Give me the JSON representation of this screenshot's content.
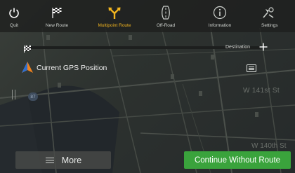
{
  "toolbar": {
    "items": [
      {
        "label": "Quit",
        "icon": "power-icon"
      },
      {
        "label": "New Route",
        "icon": "checkered-flag-icon"
      },
      {
        "label": "Multipoint Route",
        "icon": "fork-route-icon"
      },
      {
        "label": "Off-Road",
        "icon": "off-road-icon"
      },
      {
        "label": "Information",
        "icon": "info-icon"
      },
      {
        "label": "Settings",
        "icon": "settings-icon"
      }
    ],
    "active_index": 2,
    "active_color": "#f2b51f"
  },
  "route": {
    "destination_label": "Destination",
    "start_label": "Current GPS Position"
  },
  "map": {
    "street_1": "W 141st St",
    "street_2": "W 140th St",
    "road_number": "87"
  },
  "buttons": {
    "more_label": "More",
    "continue_label": "Continue Without Route",
    "continue_color": "#3aa33c"
  }
}
